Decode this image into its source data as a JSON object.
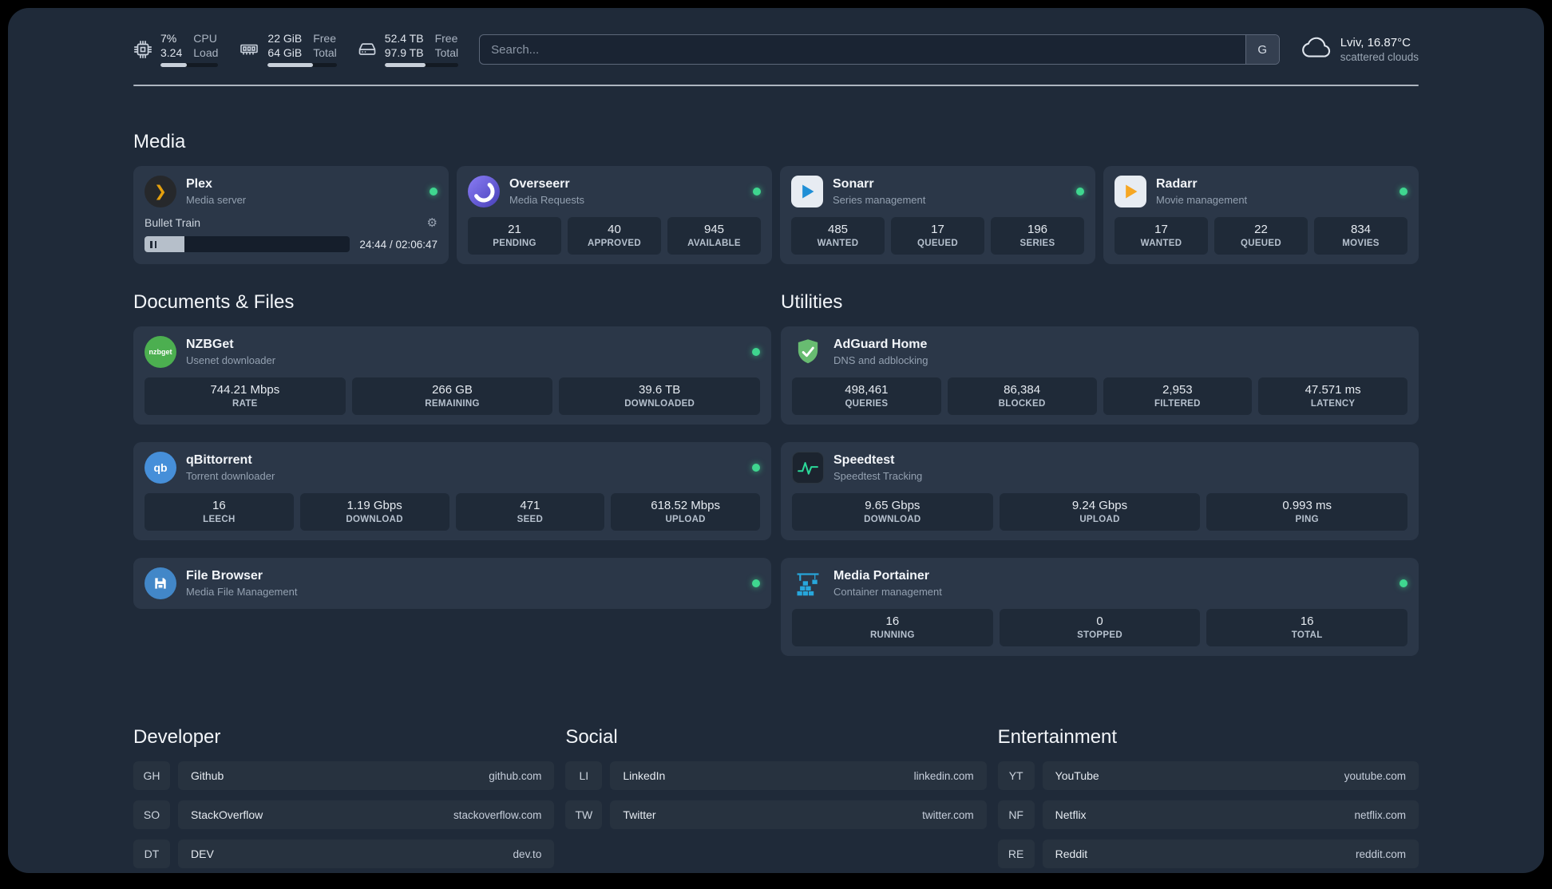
{
  "colors": {
    "status_online": "#3fd68f",
    "plex_accent": "#e5a00d",
    "background": "#1f2a39",
    "card": "#2b3748"
  },
  "icons": {
    "gear": "⚙",
    "plex_chevron": "❯"
  },
  "topbar": {
    "cpu": {
      "usage": "7%",
      "load": "3.24",
      "usage_label": "CPU",
      "load_label": "Load",
      "bar_percent": 45
    },
    "memory": {
      "free": "22 GiB",
      "total": "64 GiB",
      "free_label": "Free",
      "total_label": "Total",
      "bar_percent": 66
    },
    "disk": {
      "free": "52.4 TB",
      "total": "97.9 TB",
      "free_label": "Free",
      "total_label": "Total",
      "bar_percent": 55
    },
    "search": {
      "placeholder": "Search...",
      "provider": "G"
    },
    "weather": {
      "location": "Lviv, 16.87°C",
      "condition": "scattered clouds"
    }
  },
  "media": {
    "title": "Media",
    "plex": {
      "name": "Plex",
      "subtitle": "Media server",
      "now_playing": "Bullet Train",
      "time": "24:44 / 02:06:47",
      "progress_percent": 19.5
    },
    "overseerr": {
      "name": "Overseerr",
      "subtitle": "Media Requests",
      "stats": [
        {
          "value": "21",
          "label": "PENDING"
        },
        {
          "value": "40",
          "label": "APPROVED"
        },
        {
          "value": "945",
          "label": "AVAILABLE"
        }
      ]
    },
    "sonarr": {
      "name": "Sonarr",
      "subtitle": "Series management",
      "stats": [
        {
          "value": "485",
          "label": "WANTED"
        },
        {
          "value": "17",
          "label": "QUEUED"
        },
        {
          "value": "196",
          "label": "SERIES"
        }
      ]
    },
    "radarr": {
      "name": "Radarr",
      "subtitle": "Movie management",
      "stats": [
        {
          "value": "17",
          "label": "WANTED"
        },
        {
          "value": "22",
          "label": "QUEUED"
        },
        {
          "value": "834",
          "label": "MOVIES"
        }
      ]
    }
  },
  "documents": {
    "title": "Documents & Files",
    "nzbget": {
      "name": "NZBGet",
      "subtitle": "Usenet downloader",
      "icon_text": "nzbget",
      "stats": [
        {
          "value": "744.21 Mbps",
          "label": "RATE"
        },
        {
          "value": "266 GB",
          "label": "REMAINING"
        },
        {
          "value": "39.6 TB",
          "label": "DOWNLOADED"
        }
      ]
    },
    "qbittorrent": {
      "name": "qBittorrent",
      "subtitle": "Torrent downloader",
      "icon_text": "qb",
      "stats": [
        {
          "value": "16",
          "label": "LEECH"
        },
        {
          "value": "1.19 Gbps",
          "label": "DOWNLOAD"
        },
        {
          "value": "471",
          "label": "SEED"
        },
        {
          "value": "618.52 Mbps",
          "label": "UPLOAD"
        }
      ]
    },
    "filebrowser": {
      "name": "File Browser",
      "subtitle": "Media File Management"
    }
  },
  "utilities": {
    "title": "Utilities",
    "adguard": {
      "name": "AdGuard Home",
      "subtitle": "DNS and adblocking",
      "stats": [
        {
          "value": "498,461",
          "label": "QUERIES"
        },
        {
          "value": "86,384",
          "label": "BLOCKED"
        },
        {
          "value": "2,953",
          "label": "FILTERED"
        },
        {
          "value": "47.571 ms",
          "label": "LATENCY"
        }
      ]
    },
    "speedtest": {
      "name": "Speedtest",
      "subtitle": "Speedtest Tracking",
      "stats": [
        {
          "value": "9.65 Gbps",
          "label": "DOWNLOAD"
        },
        {
          "value": "9.24 Gbps",
          "label": "UPLOAD"
        },
        {
          "value": "0.993 ms",
          "label": "PING"
        }
      ]
    },
    "portainer": {
      "name": "Media Portainer",
      "subtitle": "Container management",
      "stats": [
        {
          "value": "16",
          "label": "RUNNING"
        },
        {
          "value": "0",
          "label": "STOPPED"
        },
        {
          "value": "16",
          "label": "TOTAL"
        }
      ]
    }
  },
  "bookmarks": {
    "developer": {
      "title": "Developer",
      "items": [
        {
          "abbr": "GH",
          "name": "Github",
          "url": "github.com"
        },
        {
          "abbr": "SO",
          "name": "StackOverflow",
          "url": "stackoverflow.com"
        },
        {
          "abbr": "DT",
          "name": "DEV",
          "url": "dev.to"
        }
      ]
    },
    "social": {
      "title": "Social",
      "items": [
        {
          "abbr": "LI",
          "name": "LinkedIn",
          "url": "linkedin.com"
        },
        {
          "abbr": "TW",
          "name": "Twitter",
          "url": "twitter.com"
        }
      ]
    },
    "entertainment": {
      "title": "Entertainment",
      "items": [
        {
          "abbr": "YT",
          "name": "YouTube",
          "url": "youtube.com"
        },
        {
          "abbr": "NF",
          "name": "Netflix",
          "url": "netflix.com"
        },
        {
          "abbr": "RE",
          "name": "Reddit",
          "url": "reddit.com"
        }
      ]
    }
  }
}
